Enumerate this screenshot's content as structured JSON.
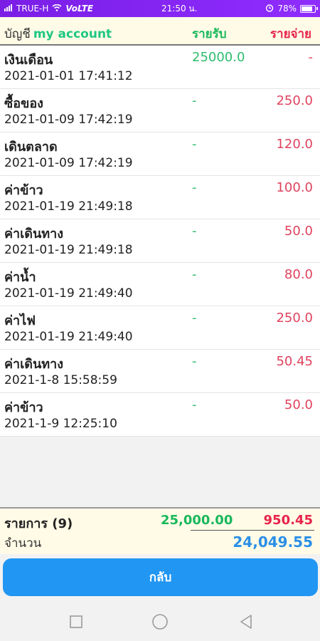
{
  "status_bar": {
    "carrier": "TRUE-H",
    "network": "VoLTE",
    "time": "21:50 น.",
    "battery": "78%"
  },
  "header": {
    "account_label": "บัญชี",
    "account_name": "my account",
    "income_label": "รายรับ",
    "expense_label": "รายจ่าย"
  },
  "entries": [
    {
      "title": "เงินเดือน",
      "date": "2021-01-01 17:41:12",
      "income": "25000.0",
      "expense": "-"
    },
    {
      "title": "ซื้อของ",
      "date": "2021-01-09 17:42:19",
      "income": "-",
      "expense": "250.0"
    },
    {
      "title": "เดินตลาด",
      "date": "2021-01-09 17:42:19",
      "income": "-",
      "expense": "120.0"
    },
    {
      "title": "ค่าข้าว",
      "date": "2021-01-19 21:49:18",
      "income": "-",
      "expense": "100.0"
    },
    {
      "title": "ค่าเดินทาง",
      "date": "2021-01-19 21:49:18",
      "income": "-",
      "expense": "50.0"
    },
    {
      "title": "ค่าน้ำ",
      "date": "2021-01-19 21:49:40",
      "income": "-",
      "expense": "80.0"
    },
    {
      "title": "ค่าไฟ",
      "date": "2021-01-19 21:49:40",
      "income": "-",
      "expense": "250.0"
    },
    {
      "title": "ค่าเดินทาง",
      "date": "2021-1-8 15:58:59",
      "income": "-",
      "expense": "50.45"
    },
    {
      "title": "ค่าข้าว",
      "date": "2021-1-9 12:25:10",
      "income": "-",
      "expense": "50.0"
    }
  ],
  "summary": {
    "items_label": "รายการ (9)",
    "total_income": "25,000.00",
    "total_expense": "950.45",
    "quantity_label": "จำนวน",
    "balance": "24,049.55"
  },
  "back_button": "กลับ",
  "colors": {
    "income": "#19b85c",
    "expense": "#e8234a",
    "balance": "#2b8fe6",
    "button": "#2196f3",
    "status_bar": "#8a2be2"
  },
  "icons": {
    "nav_recent": "square-icon",
    "nav_home": "circle-icon",
    "nav_back": "triangle-left-icon"
  }
}
